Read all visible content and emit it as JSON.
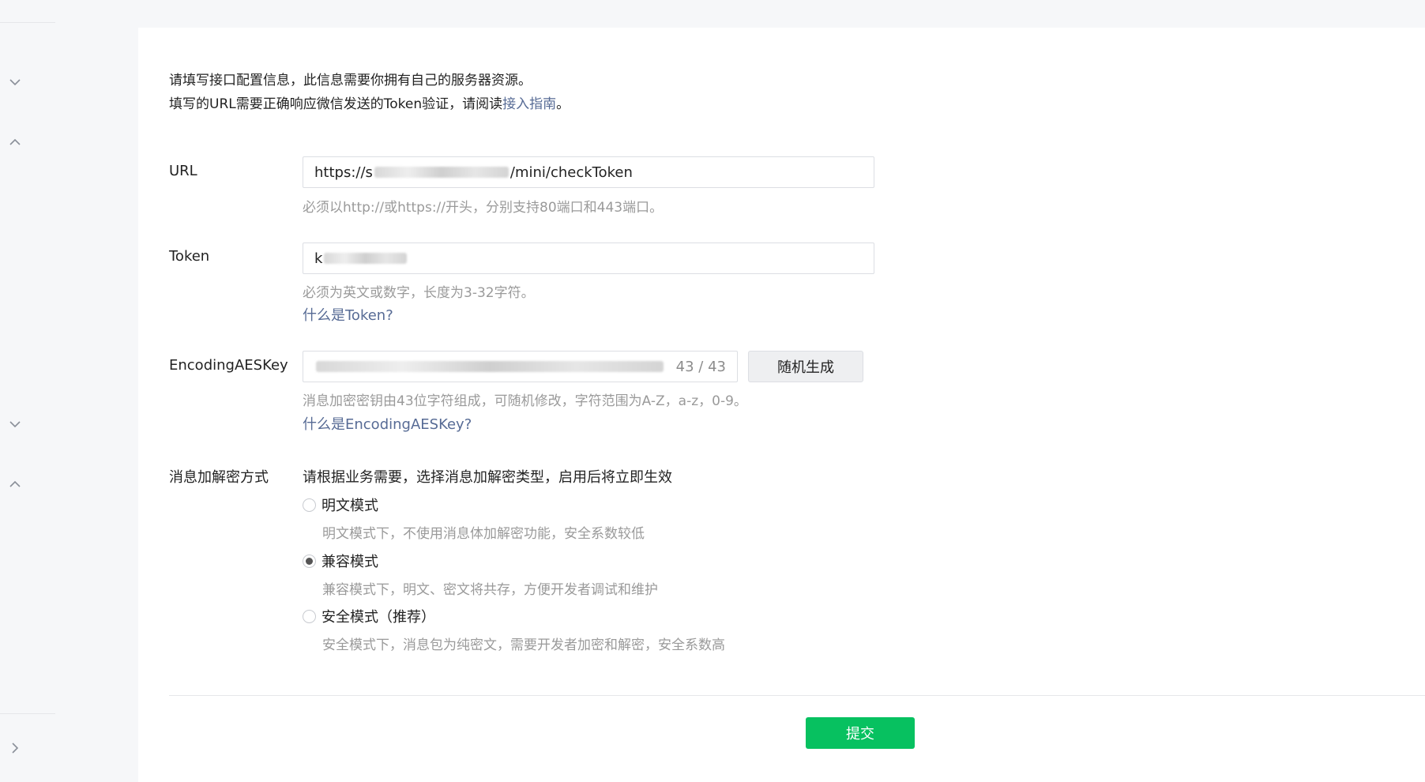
{
  "intro": {
    "line1": "请填写接口配置信息，此信息需要你拥有自己的服务器资源。",
    "line2_prefix": "填写的URL需要正确响应微信发送的Token验证，请阅读",
    "line2_link": "接入指南",
    "line2_suffix": "。"
  },
  "url": {
    "label": "URL",
    "value_prefix": "https://s",
    "value_suffix": "/mini/checkToken",
    "hint": "必须以http://或https://开头，分别支持80端口和443端口。"
  },
  "token": {
    "label": "Token",
    "value_prefix": "k",
    "hint": "必须为英文或数字，长度为3-32字符。",
    "help_link": "什么是Token?"
  },
  "aes": {
    "label": "EncodingAESKey",
    "counter": "43 / 43",
    "generate_button": "随机生成",
    "hint": "消息加密密钥由43位字符组成，可随机修改，字符范围为A-Z，a-z，0-9。",
    "help_link": "什么是EncodingAESKey?"
  },
  "encryption": {
    "label": "消息加解密方式",
    "description": "请根据业务需要，选择消息加解密类型，启用后将立即生效",
    "options": [
      {
        "label": "明文模式",
        "desc": "明文模式下，不使用消息体加解密功能，安全系数较低",
        "checked": false
      },
      {
        "label": "兼容模式",
        "desc": "兼容模式下，明文、密文将共存，方便开发者调试和维护",
        "checked": true
      },
      {
        "label": "安全模式（推荐）",
        "desc": "安全模式下，消息包为纯密文，需要开发者加密和解密，安全系数高",
        "checked": false
      }
    ]
  },
  "submit_button": "提交",
  "icons": {
    "sidebar_toggle_1": "chevron-down-icon",
    "sidebar_toggle_2": "chevron-up-icon",
    "sidebar_toggle_3": "chevron-down-icon",
    "sidebar_toggle_4": "chevron-up-icon",
    "sidebar_toggle_5": "chevron-right-icon"
  },
  "colors": {
    "primary": "#07c160",
    "link": "#576b95"
  }
}
